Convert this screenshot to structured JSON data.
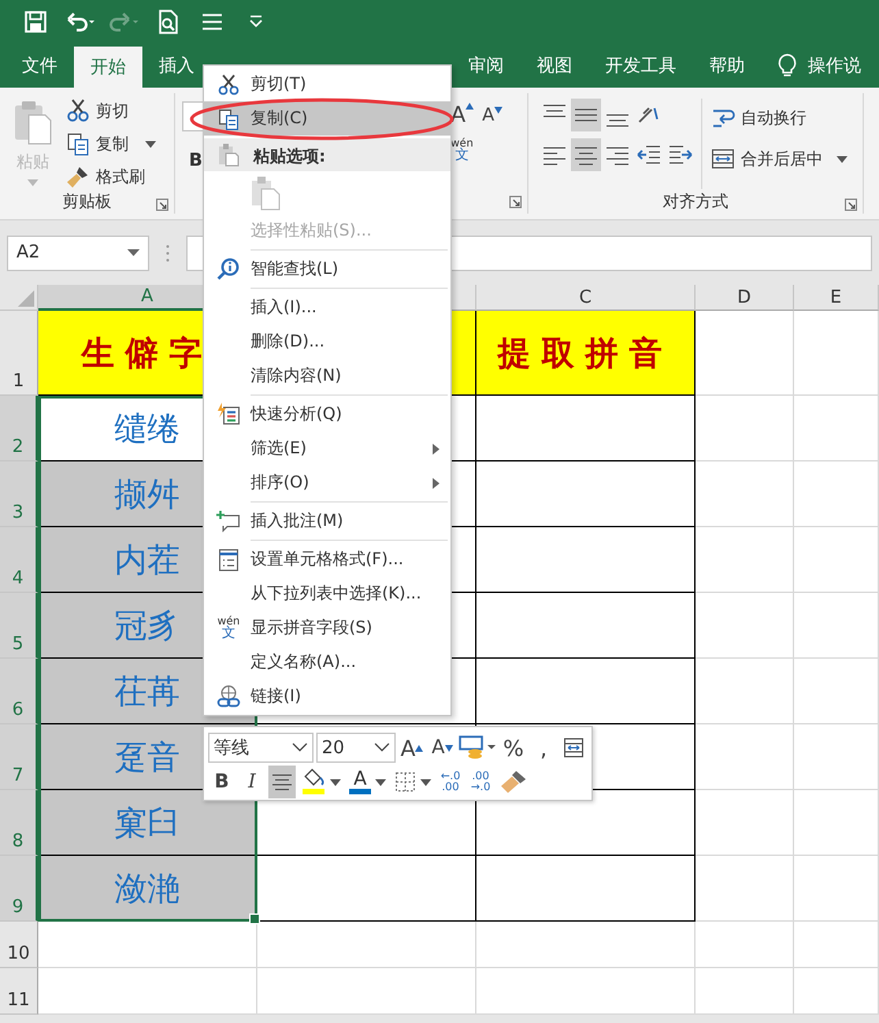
{
  "quick_access_toolbar": [
    {
      "kind": "save",
      "disabled": false
    },
    {
      "kind": "undo",
      "disabled": false
    },
    {
      "kind": "redo",
      "disabled": true
    },
    {
      "kind": "print_preview",
      "disabled": false
    },
    {
      "kind": "touch_mode",
      "disabled": false
    },
    {
      "kind": "customize",
      "disabled": false
    }
  ],
  "tabs": [
    {
      "label": "文件",
      "selected": false
    },
    {
      "label": "开始",
      "selected": true
    },
    {
      "label": "插入",
      "selected": false
    },
    {
      "label": "审阅",
      "selected": false
    },
    {
      "label": "视图",
      "selected": false
    },
    {
      "label": "开发工具",
      "selected": false
    },
    {
      "label": "帮助",
      "selected": false
    }
  ],
  "tell_me": "操作说",
  "ribbon": {
    "clipboard": {
      "title": "剪贴板",
      "paste": {
        "label": "粘贴",
        "disabled": true
      },
      "commands": [
        {
          "kind": "cut",
          "label": "剪切",
          "dropdown": false
        },
        {
          "kind": "copy",
          "label": "复制",
          "dropdown": true
        },
        {
          "kind": "format_painter",
          "label": "格式刷",
          "dropdown": false
        }
      ]
    },
    "font": {
      "bold_label": "B",
      "grow_label": "A",
      "shrink_label": "A",
      "phonetic_label": [
        "wén",
        "文"
      ]
    },
    "alignment": {
      "title": "对齐方式",
      "buttons": [
        {
          "kind": "top",
          "selected": false
        },
        {
          "kind": "middle",
          "selected": true
        },
        {
          "kind": "bottom",
          "selected": false
        },
        {
          "kind": "orientation",
          "selected": false
        },
        {
          "kind": "left",
          "selected": false
        },
        {
          "kind": "center",
          "selected": true
        },
        {
          "kind": "right",
          "selected": false
        },
        {
          "kind": "outdent",
          "selected": false
        },
        {
          "kind": "indent",
          "selected": false
        }
      ],
      "wrap_text": "自动换行",
      "merge_center": "合并后居中"
    }
  },
  "name_box": "A2",
  "columns": [
    {
      "label": "A",
      "selected": true
    },
    {
      "selected": false
    },
    {
      "label": "C",
      "selected": false
    },
    {
      "label": "D",
      "selected": false
    },
    {
      "label": "E",
      "selected": false
    }
  ],
  "rows": [
    {
      "number": "1",
      "selected": false,
      "kind": "header",
      "cell_a": "生僻字",
      "cell_c": "提取拼音"
    },
    {
      "number": "2",
      "selected": true,
      "kind": "data",
      "active": true,
      "cell_a": "缱绻"
    },
    {
      "number": "3",
      "selected": true,
      "kind": "data",
      "active": false,
      "cell_a": "撷舛"
    },
    {
      "number": "4",
      "selected": true,
      "kind": "data",
      "active": false,
      "cell_a": "内茬"
    },
    {
      "number": "5",
      "selected": true,
      "kind": "data",
      "active": false,
      "cell_a": "冠豸"
    },
    {
      "number": "6",
      "selected": true,
      "kind": "data",
      "active": false,
      "cell_a": "茌苒"
    },
    {
      "number": "7",
      "selected": true,
      "kind": "data",
      "active": false,
      "cell_a": "趸音"
    },
    {
      "number": "8",
      "selected": true,
      "kind": "data",
      "active": false,
      "cell_a": "窠臼"
    },
    {
      "number": "9",
      "selected": true,
      "kind": "data",
      "active": false,
      "cell_a": "潋滟"
    },
    {
      "number": "10",
      "selected": false,
      "kind": "blank"
    },
    {
      "number": "11",
      "selected": false,
      "kind": "blank"
    }
  ],
  "context_menu": [
    {
      "kind": "item",
      "label": "剪切(T)",
      "disabled": false,
      "selected": false,
      "submenu": false
    },
    {
      "kind": "item",
      "label": "复制(C)",
      "disabled": false,
      "selected": true,
      "submenu": false
    },
    {
      "kind": "header",
      "label": "粘贴选项:"
    },
    {
      "kind": "paste_option",
      "disabled": true
    },
    {
      "kind": "item",
      "label": "选择性粘贴(S)...",
      "disabled": true,
      "selected": false,
      "submenu": false
    },
    {
      "kind": "separator"
    },
    {
      "kind": "item",
      "label": "智能查找(L)",
      "disabled": false,
      "selected": false,
      "submenu": false
    },
    {
      "kind": "separator"
    },
    {
      "kind": "item",
      "label": "插入(I)...",
      "disabled": false,
      "selected": false,
      "submenu": false
    },
    {
      "kind": "item",
      "label": "删除(D)...",
      "disabled": false,
      "selected": false,
      "submenu": false
    },
    {
      "kind": "item",
      "label": "清除内容(N)",
      "disabled": false,
      "selected": false,
      "submenu": false
    },
    {
      "kind": "separator"
    },
    {
      "kind": "item",
      "label": "快速分析(Q)",
      "disabled": false,
      "selected": false,
      "submenu": false
    },
    {
      "kind": "item",
      "label": "筛选(E)",
      "disabled": false,
      "selected": false,
      "submenu": true
    },
    {
      "kind": "item",
      "label": "排序(O)",
      "disabled": false,
      "selected": false,
      "submenu": true
    },
    {
      "kind": "separator"
    },
    {
      "kind": "item",
      "label": "插入批注(M)",
      "disabled": false,
      "selected": false,
      "submenu": false
    },
    {
      "kind": "separator"
    },
    {
      "kind": "item",
      "label": "设置单元格格式(F)...",
      "disabled": false,
      "selected": false,
      "submenu": false
    },
    {
      "kind": "item",
      "label": "从下拉列表中选择(K)...",
      "disabled": false,
      "selected": false,
      "submenu": false
    },
    {
      "kind": "item",
      "icon_label": [
        "wén",
        "文"
      ],
      "label": "显示拼音字段(S)",
      "disabled": false,
      "selected": false,
      "submenu": false
    },
    {
      "kind": "item",
      "label": "定义名称(A)...",
      "disabled": false,
      "selected": false,
      "submenu": false
    },
    {
      "kind": "item",
      "label": "链接(I)",
      "disabled": false,
      "selected": false,
      "submenu": false
    }
  ],
  "mini_toolbar": {
    "font": "等线",
    "size": "20",
    "row1": [
      {
        "kind": "grow",
        "label": "A"
      },
      {
        "kind": "shrink",
        "label": "A"
      },
      {
        "kind": "accounting"
      },
      {
        "kind": "percent",
        "label": "%"
      },
      {
        "kind": "comma",
        "label": ","
      },
      {
        "kind": "format_table"
      }
    ],
    "row2": [
      {
        "kind": "bold",
        "label": "B",
        "selected": false
      },
      {
        "kind": "italic",
        "label": "I",
        "selected": false
      },
      {
        "kind": "center",
        "selected": true
      },
      {
        "kind": "fill_color",
        "color": "#ffff00",
        "selected": false
      },
      {
        "kind": "font_color",
        "label": "A",
        "color": "#0070c0",
        "selected": false
      },
      {
        "kind": "borders",
        "selected": false
      },
      {
        "kind": "increase_decimal",
        "label": [
          "←.0",
          ".00"
        ],
        "selected": false
      },
      {
        "kind": "decrease_decimal",
        "label": [
          ".00",
          "→.0"
        ],
        "selected": false
      },
      {
        "kind": "format_painter",
        "selected": false
      }
    ]
  },
  "annotation": {
    "kind": "ellipse"
  }
}
